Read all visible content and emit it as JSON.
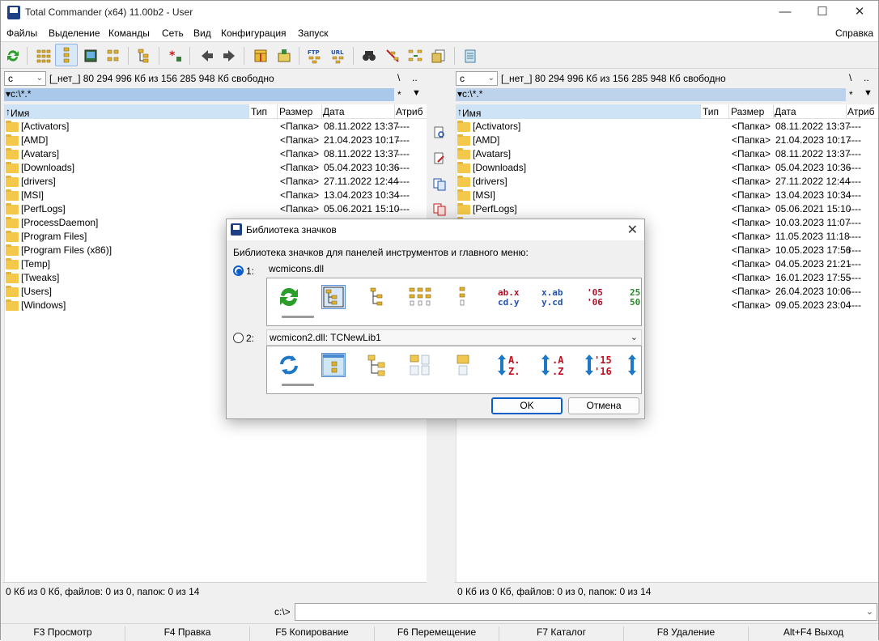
{
  "window": {
    "title": "Total Commander (x64) 11.00b2 - User"
  },
  "menu": {
    "items": [
      "Файлы",
      "Выделение",
      "Команды",
      "Сеть",
      "Вид",
      "Конфигурация",
      "Запуск"
    ],
    "help": "Справка"
  },
  "toolbar": {
    "icons": [
      "refresh-icon",
      "brief-view-icon",
      "tree-view-icon",
      "thumbnails-icon",
      "branch-view-icon",
      "tree-compare-icon",
      "invert-selection-icon",
      "back-icon",
      "forward-icon",
      "pack-icon",
      "unpack-icon",
      "ftp-connect-icon",
      "url-connect-icon",
      "find-files-icon",
      "multi-rename-icon",
      "sync-dirs-icon",
      "file-compare-icon",
      "notepad-icon"
    ]
  },
  "left": {
    "drive": "c",
    "drive_info": "[_нет_]  80 294 996 Кб из 156 285 948 Кб свободно",
    "root_btn": "\\",
    "up_btn": "..",
    "path": "c:\\*.*",
    "filter_btn": "*",
    "columns": {
      "name": "Имя",
      "type": "Тип",
      "size": "Размер",
      "date": "Дата",
      "attr": "Атриб"
    },
    "rows": [
      {
        "name": "[Activators]",
        "size": "<Папка>",
        "date": "08.11.2022 13:37",
        "attr": "----"
      },
      {
        "name": "[AMD]",
        "size": "<Папка>",
        "date": "21.04.2023 10:17",
        "attr": "----"
      },
      {
        "name": "[Avatars]",
        "size": "<Папка>",
        "date": "08.11.2022 13:37",
        "attr": "----"
      },
      {
        "name": "[Downloads]",
        "size": "<Папка>",
        "date": "05.04.2023 10:36",
        "attr": "----"
      },
      {
        "name": "[drivers]",
        "size": "<Папка>",
        "date": "27.11.2022 12:44",
        "attr": "----"
      },
      {
        "name": "[MSI]",
        "size": "<Папка>",
        "date": "13.04.2023 10:34",
        "attr": "----"
      },
      {
        "name": "[PerfLogs]",
        "size": "<Папка>",
        "date": "05.06.2021 15:10",
        "attr": "----"
      },
      {
        "name": "[ProcessDaemon]",
        "size": "",
        "date": "",
        "attr": ""
      },
      {
        "name": "[Program Files]",
        "size": "",
        "date": "",
        "attr": ""
      },
      {
        "name": "[Program Files (x86)]",
        "size": "",
        "date": "",
        "attr": ""
      },
      {
        "name": "[Temp]",
        "size": "",
        "date": "",
        "attr": ""
      },
      {
        "name": "[Tweaks]",
        "size": "",
        "date": "",
        "attr": ""
      },
      {
        "name": "[Users]",
        "size": "",
        "date": "",
        "attr": ""
      },
      {
        "name": "[Windows]",
        "size": "",
        "date": "",
        "attr": ""
      }
    ],
    "status": "0 Кб из 0 Кб, файлов: 0 из 0, папок: 0 из 14"
  },
  "right": {
    "drive": "c",
    "drive_info": "[_нет_]  80 294 996 Кб из 156 285 948 Кб свободно",
    "root_btn": "\\",
    "up_btn": "..",
    "path": "c:\\*.*",
    "filter_btn": "*",
    "columns": {
      "name": "Имя",
      "type": "Тип",
      "size": "Размер",
      "date": "Дата",
      "attr": "Атриб"
    },
    "rows": [
      {
        "name": "[Activators]",
        "size": "<Папка>",
        "date": "08.11.2022 13:37",
        "attr": "----"
      },
      {
        "name": "[AMD]",
        "size": "<Папка>",
        "date": "21.04.2023 10:17",
        "attr": "----"
      },
      {
        "name": "[Avatars]",
        "size": "<Папка>",
        "date": "08.11.2022 13:37",
        "attr": "----"
      },
      {
        "name": "[Downloads]",
        "size": "<Папка>",
        "date": "05.04.2023 10:36",
        "attr": "----"
      },
      {
        "name": "[drivers]",
        "size": "<Папка>",
        "date": "27.11.2022 12:44",
        "attr": "----"
      },
      {
        "name": "[MSI]",
        "size": "<Папка>",
        "date": "13.04.2023 10:34",
        "attr": "----"
      },
      {
        "name": "[PerfLogs]",
        "size": "<Папка>",
        "date": "05.06.2021 15:10",
        "attr": "----"
      },
      {
        "name": "",
        "size": "<Папка>",
        "date": "10.03.2023 11:07",
        "attr": "----"
      },
      {
        "name": "",
        "size": "<Папка>",
        "date": "11.05.2023 11:18",
        "attr": "----"
      },
      {
        "name": "",
        "size": "<Папка>",
        "date": "10.05.2023 17:56",
        "attr": "r---"
      },
      {
        "name": "",
        "size": "<Папка>",
        "date": "04.05.2023 21:21",
        "attr": "----"
      },
      {
        "name": "",
        "size": "<Папка>",
        "date": "16.01.2023 17:55",
        "attr": "----"
      },
      {
        "name": "",
        "size": "<Папка>",
        "date": "26.04.2023 10:06",
        "attr": "----"
      },
      {
        "name": "",
        "size": "<Папка>",
        "date": "09.05.2023 23:04",
        "attr": "----"
      }
    ],
    "status": "0 Кб из 0 Кб, файлов: 0 из 0, папок: 0 из 14"
  },
  "cmd": {
    "prompt": "c:\\>",
    "value": ""
  },
  "fkeys": [
    "F3 Просмотр",
    "F4 Правка",
    "F5 Копирование",
    "F6 Перемещение",
    "F7 Каталог",
    "F8 Удаление",
    "Alt+F4 Выход"
  ],
  "dialog": {
    "title": "Библиотека значков",
    "description": "Библиотека значков для панелей инструментов и главного меню:",
    "option1_label": "1:",
    "option1_lib": "wcmicons.dll",
    "option1_selected": true,
    "option2_label": "2:",
    "option2_lib": "wcmicon2.dll: TCNewLib1",
    "option2_selected": false,
    "strip1_text": {
      "abx": "ab.x",
      "cdy": "cd.y",
      "xab": "x.ab",
      "ycd": "y.cd",
      "y05": "'05",
      "y06": "'06",
      "n25": "25",
      "n50": "50"
    },
    "strip2_text": {
      "a1": "A.",
      "z1": "Z.",
      "a2": ".A",
      "z2": ".Z",
      "y15": "'15",
      "y16": "'16"
    },
    "ok": "OK",
    "cancel": "Отмена"
  },
  "colors": {
    "accent": "#0b5ec7",
    "path_active": "#a9c8ea",
    "folder": "#f4c84a",
    "green_refresh": "#2a9d2a",
    "blue_arrow": "#1e78c8",
    "red_text": "#b0102a"
  }
}
